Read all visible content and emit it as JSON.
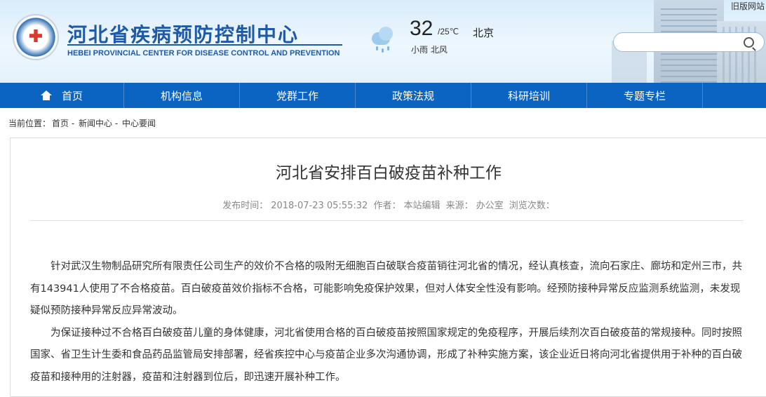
{
  "header": {
    "org_name_cn": "河北省疾病预防控制中心",
    "org_name_en": "HEBEI PROVINCIAL CENTER FOR DISEASE CONTROL AND PREVENTION",
    "old_site_link": "旧版网站",
    "search_placeholder": "",
    "weather": {
      "icon": "cloud-rain-icon",
      "temperature": "32",
      "range": "/25℃",
      "city": "北京",
      "description": "小雨 北风"
    }
  },
  "nav": {
    "items": [
      {
        "label": "首页",
        "icon": "home-icon"
      },
      {
        "label": "机构信息"
      },
      {
        "label": "党群工作"
      },
      {
        "label": "政策法规"
      },
      {
        "label": "科研培训"
      },
      {
        "label": "专题专栏"
      }
    ]
  },
  "breadcrumb": {
    "prefix": "当前位置：",
    "items": [
      "首页",
      "新闻中心",
      "中心要闻"
    ],
    "separator": " - "
  },
  "article": {
    "title": "河北省安排百白破疫苗补种工作",
    "meta": {
      "publish_label": "发布时间：",
      "publish_time": "2018-07-23 05:55:32",
      "author_label": "作者：",
      "author": "本站编辑",
      "source_label": "来源：",
      "source": "办公室",
      "views_label": "浏览次数："
    },
    "paragraphs": [
      "针对武汉生物制品研究所有限责任公司生产的效价不合格的吸附无细胞百白破联合疫苗销往河北省的情况，经认真核查，流向石家庄、廊坊和定州三市，共有143941人使用了不合格疫苗。百白破疫苗效价指标不合格，可能影响免疫保护效果，但对人体安全性没有影响。经预防接种异常反应监测系统监测，未发现疑似预防接种异常反应异常波动。",
      "为保证接种过不合格百白破疫苗儿童的身体健康，河北省使用合格的百白破疫苗按照国家规定的免疫程序，开展后续剂次百白破疫苗的常规接种。同时按照国家、省卫生计生委和食品药品监管局安排部署，经省疾控中心与疫苗企业多次沟通协调，形成了补种实施方案，该企业近日将向河北省提供用于补种的百白破疫苗和接种用的注射器，疫苗和注射器到位后，即迅速开展补种工作。"
    ]
  },
  "colors": {
    "nav_bg": "#0c64c2",
    "brand_blue": "#1e5aa8"
  }
}
